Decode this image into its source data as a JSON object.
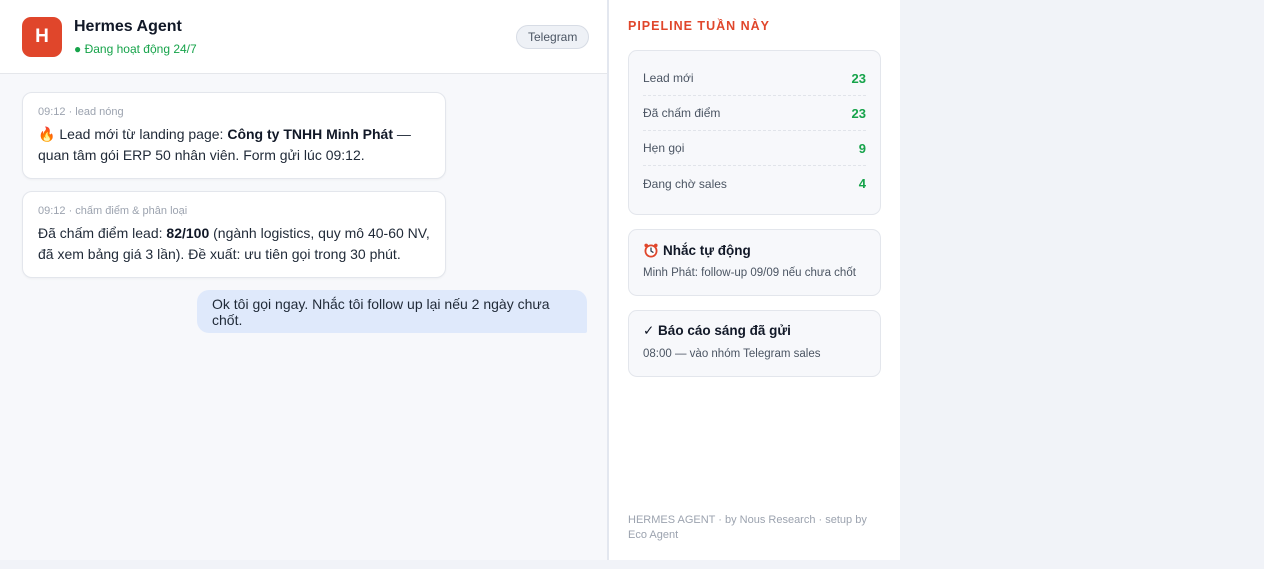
{
  "header": {
    "avatar_letter": "H",
    "agent_name": "Hermes Agent",
    "status": "● Đang hoạt động 24/7",
    "channel": "Telegram"
  },
  "messages": [
    {
      "meta": "09:12 · lead nóng",
      "prefix": "🔥 Lead mới từ landing page: ",
      "bold": "Công ty TNHH Minh Phát",
      "suffix": " — quan tâm gói ERP 50 nhân viên. Form gửi lúc 09:12."
    },
    {
      "meta": "09:12 · chấm điểm & phân loại",
      "prefix": "Đã chấm điểm lead: ",
      "bold": "82/100",
      "suffix": " (ngành logistics, quy mô 40-60 NV, đã xem bảng giá 3 lần). Đề xuất: ưu tiên gọi trong 30 phút."
    }
  ],
  "user_message": "Ok tôi gọi ngay. Nhắc tôi follow up lại nếu 2 ngày chưa chốt.",
  "sidebar": {
    "title": "PIPELINE TUẦN NÀY",
    "pipeline": [
      {
        "label": "Lead mới",
        "value": "23"
      },
      {
        "label": "Đã chấm điểm",
        "value": "23"
      },
      {
        "label": "Hẹn gọi",
        "value": "9"
      },
      {
        "label": "Đang chờ sales",
        "value": "4"
      }
    ],
    "reminder": {
      "icon": "alarm-clock-icon",
      "title": "Nhắc tự động",
      "desc": "Minh Phát: follow-up 09/09 nếu chưa chốt"
    },
    "report": {
      "icon": "check-icon",
      "title": "✓ Báo cáo sáng đã gửi",
      "desc": "08:00 — vào nhóm Telegram sales"
    },
    "footer": "HERMES AGENT · by Nous Research · setup by Eco Agent"
  },
  "colors": {
    "accent": "#e0462b",
    "success": "#16a34a",
    "user_bubble": "#dfe9fb"
  }
}
